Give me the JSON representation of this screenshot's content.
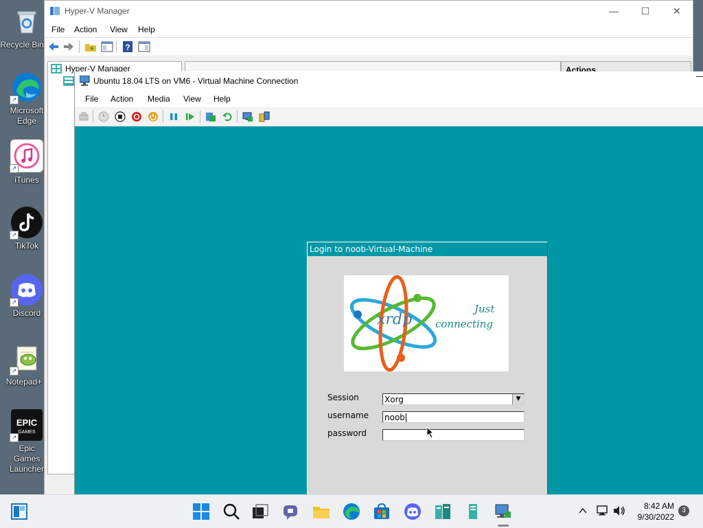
{
  "desktop": {
    "icons": [
      {
        "label": "Recycle Bin",
        "icon": "recycle-bin-icon"
      },
      {
        "label": "Microsoft Edge",
        "icon": "edge-icon"
      },
      {
        "label": "iTunes",
        "icon": "itunes-icon"
      },
      {
        "label": "TikTok",
        "icon": "tiktok-icon"
      },
      {
        "label": "Discord",
        "icon": "discord-icon"
      },
      {
        "label": "Notepad+",
        "icon": "notepad-plus-icon"
      },
      {
        "label": "Epic Games Launcher",
        "icon": "epic-games-icon"
      }
    ]
  },
  "hyperv": {
    "title": "Hyper-V Manager",
    "menu": [
      "File",
      "Action",
      "View",
      "Help"
    ],
    "tree_root": "Hyper-V Manager",
    "actions_header": "Actions"
  },
  "vm": {
    "title": "Ubuntu 18.04 LTS on VM6 - Virtual Machine Connection",
    "menu": [
      "File",
      "Action",
      "Media",
      "View",
      "Help"
    ]
  },
  "login": {
    "title": "Login to noob-Virtual-Machine",
    "logo_word": "xrdp",
    "logo_tagline_1": "Just",
    "logo_tagline_2": "connecting",
    "session_label": "Session",
    "session_value": "Xorg",
    "username_label": "username",
    "username_value": "noob",
    "password_label": "password",
    "password_value": ""
  },
  "taskbar": {
    "time": "8:42 AM",
    "date": "9/30/2022",
    "notification_count": "3"
  },
  "colors": {
    "vm_background": "#0097a7",
    "login_panel": "#d9d9d9"
  }
}
